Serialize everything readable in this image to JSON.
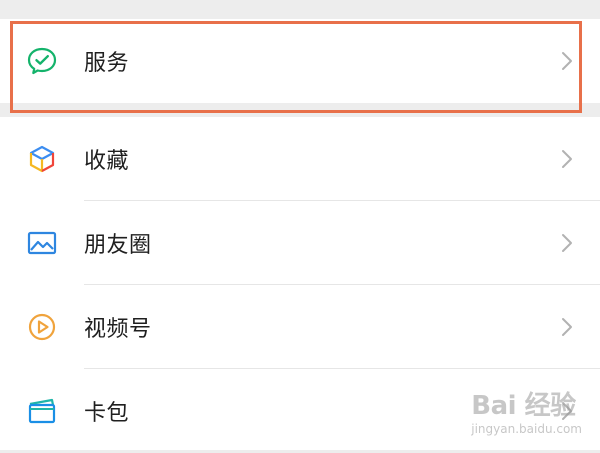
{
  "menu": {
    "group1": [
      {
        "label": "服务",
        "icon": "services-icon"
      }
    ],
    "group2": [
      {
        "label": "收藏",
        "icon": "favorites-icon"
      },
      {
        "label": "朋友圈",
        "icon": "moments-icon"
      },
      {
        "label": "视频号",
        "icon": "channels-icon"
      },
      {
        "label": "卡包",
        "icon": "card-wallet-icon"
      }
    ]
  },
  "highlight": {
    "color": "#e8704a"
  },
  "watermark": {
    "top": "Bai 经验",
    "bottom": "jingyan.baidu.com"
  }
}
